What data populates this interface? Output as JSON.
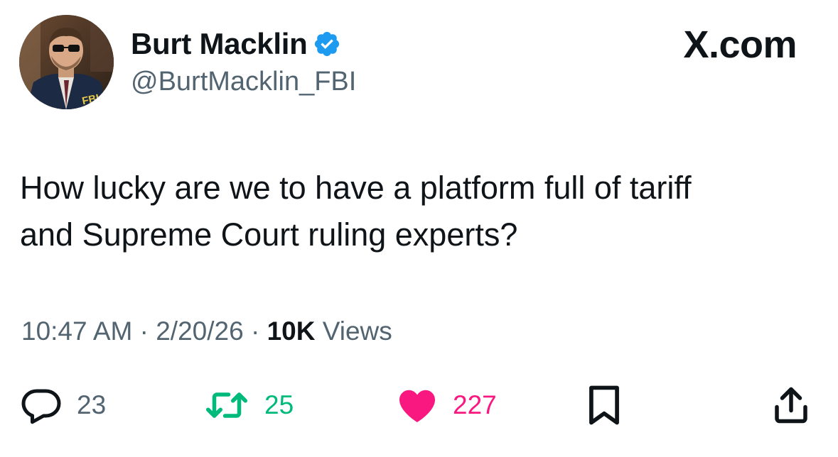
{
  "author": {
    "display_name": "Burt Macklin",
    "handle": "@BurtMacklin_FBI",
    "verified": true,
    "avatar_text": "FBI"
  },
  "source_label": "X.com",
  "tweet": {
    "text_line1": "How lucky are we to have a platform full of tariff",
    "text_line2": "and Supreme Court ruling experts?",
    "time": "10:47 AM",
    "date": "2/20/26",
    "separator": "·",
    "views_count": "10K",
    "views_label": "Views"
  },
  "actions": {
    "reply_count": "23",
    "retweet_count": "25",
    "like_count": "227",
    "liked": true,
    "retweeted": true
  },
  "colors": {
    "text_primary": "#0f1419",
    "text_secondary": "#536471",
    "verified_blue": "#1d9bf0",
    "retweet_green": "#00ba7c",
    "like_pink": "#f91880"
  },
  "icons": {
    "reply": "speech-bubble-icon",
    "retweet": "retweet-arrows-icon",
    "like": "heart-icon",
    "bookmark": "bookmark-icon",
    "share": "share-upload-icon",
    "verified": "verified-badge-icon"
  }
}
